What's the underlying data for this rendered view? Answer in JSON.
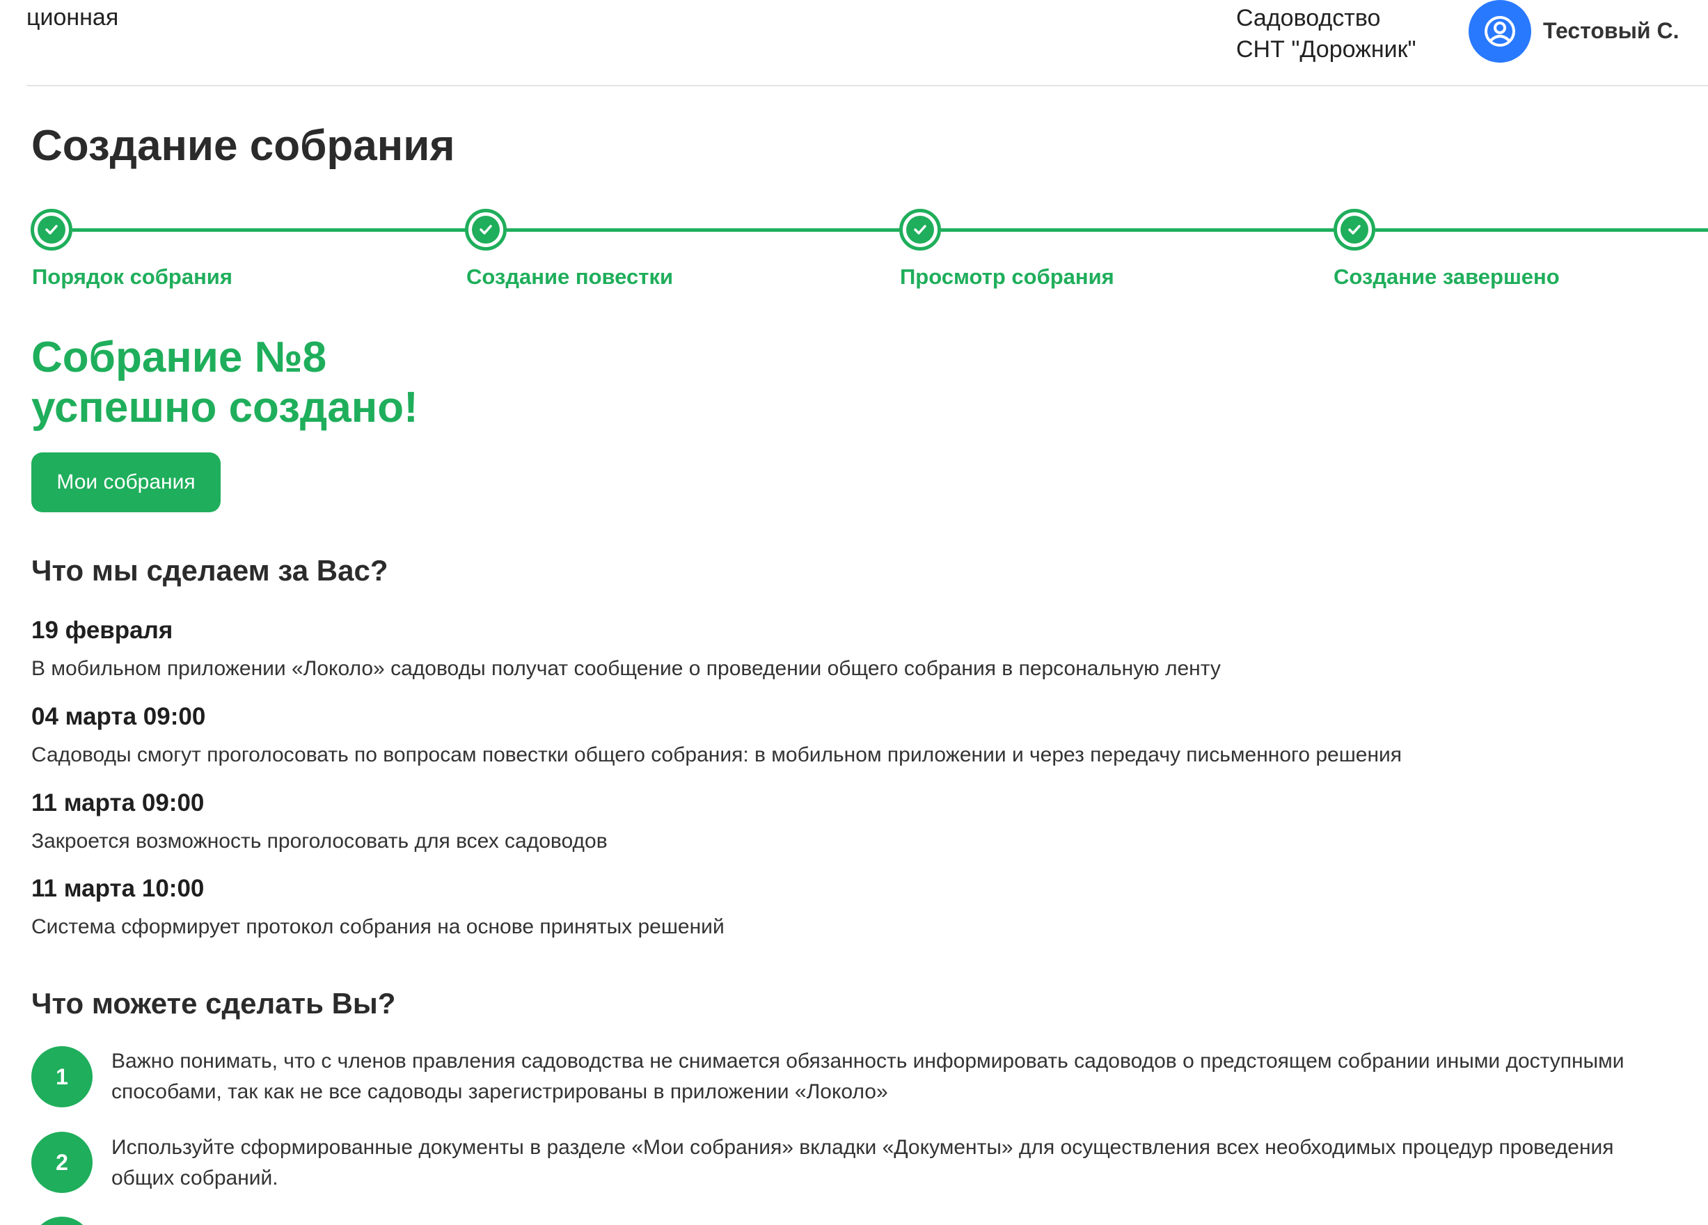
{
  "header": {
    "left_text": "ционная",
    "org_label": "Садоводство",
    "org_name": "СНТ \"Дорожник\"",
    "user_name": "Тестовый С.",
    "avatar_color": "#2979ff"
  },
  "page_title": "Создание собрания",
  "stepper": {
    "accent_color": "#1fae5b",
    "steps": [
      {
        "label": "Порядок собрания",
        "status": "completed"
      },
      {
        "label": "Создание повестки",
        "status": "completed"
      },
      {
        "label": "Просмотр собрания",
        "status": "completed"
      },
      {
        "label": "Создание завершено",
        "status": "completed"
      }
    ]
  },
  "success": {
    "line1": "Собрание №8",
    "line2": "успешно создано!"
  },
  "my_meetings_button": "Мои собрания",
  "what_we_do": {
    "title": "Что мы сделаем за Вас?",
    "items": [
      {
        "date": "19 февраля",
        "text": "В мобильном приложении «Локоло» садоводы получат сообщение о проведении общего собрания в персональную ленту"
      },
      {
        "date": "04 марта 09:00",
        "text": "Садоводы смогут проголосовать по вопросам повестки общего собрания: в мобильном приложении и через передачу письменного решения"
      },
      {
        "date": "11 марта 09:00",
        "text": "Закроется возможность проголосовать для всех садоводов"
      },
      {
        "date": "11 марта 10:00",
        "text": "Система сформирует протокол собрания на основе принятых решений"
      }
    ]
  },
  "what_you_do": {
    "title": "Что можете сделать Вы?",
    "items": [
      {
        "number": "1",
        "text": "Важно понимать, что с членов правления садоводства не снимается обязанность информировать садоводов о предстоящем собрании иными доступными способами, так как не все садоводы зарегистрированы в приложении «Локоло»"
      },
      {
        "number": "2",
        "text": "Используйте сформированные документы в разделе «Мои собрания» вкладки «Документы» для осуществления всех необходимых процедур проведения общих собраний."
      }
    ]
  }
}
